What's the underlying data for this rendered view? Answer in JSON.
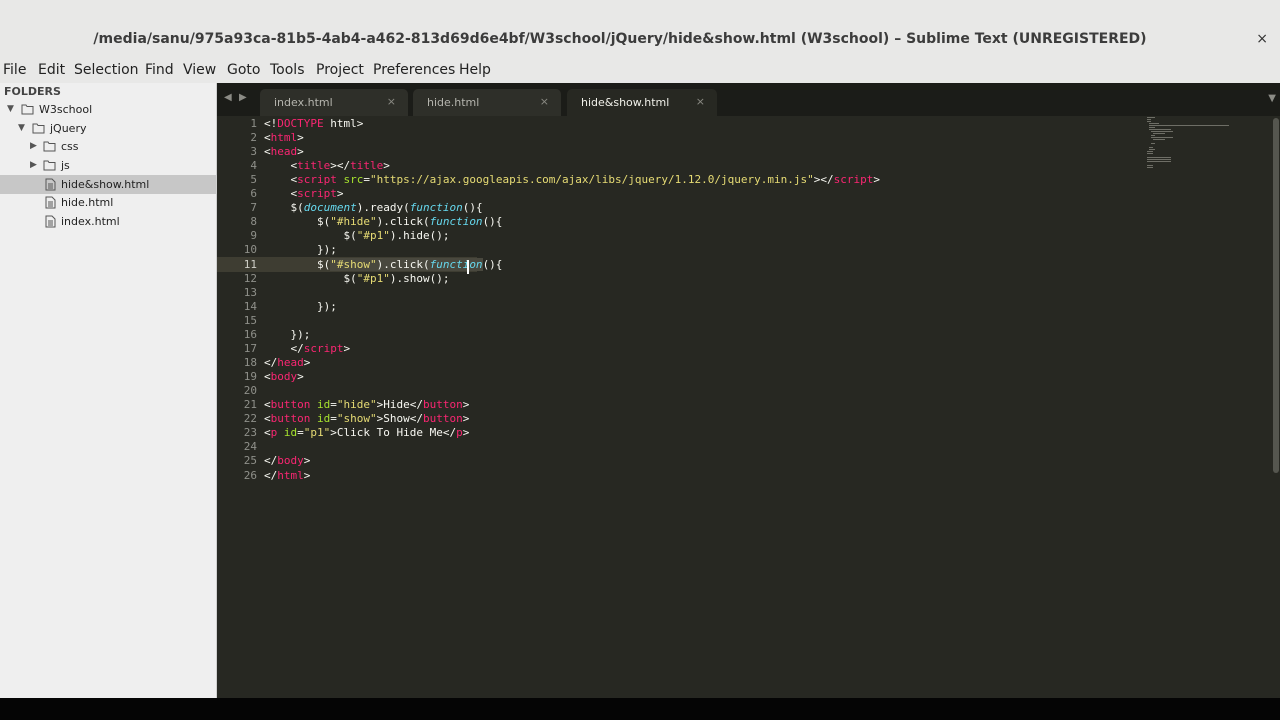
{
  "window": {
    "title": "/media/sanu/975a93ca-81b5-4ab4-a462-813d69d6e4bf/W3school/jQuery/hide&show.html (W3school) – Sublime Text (UNREGISTERED)",
    "close_glyph": "×"
  },
  "menu": [
    "File",
    "Edit",
    "Selection",
    "Find",
    "View",
    "Goto",
    "Tools",
    "Project",
    "Preferences",
    "Help"
  ],
  "sidebar": {
    "header": "FOLDERS",
    "tree": [
      {
        "label": "W3school",
        "type": "folder-open"
      },
      {
        "label": "jQuery",
        "type": "folder-open"
      },
      {
        "label": "css",
        "type": "folder"
      },
      {
        "label": "js",
        "type": "folder"
      },
      {
        "label": "hide&show.html",
        "type": "file"
      },
      {
        "label": "hide.html",
        "type": "file"
      },
      {
        "label": "index.html",
        "type": "file"
      }
    ]
  },
  "tabs": [
    {
      "label": "index.html",
      "close": "×"
    },
    {
      "label": "hide.html",
      "close": "×"
    },
    {
      "label": "hide&show.html",
      "close": "×"
    }
  ],
  "editor": {
    "line_numbers": [
      "1",
      "2",
      "3",
      "4",
      "5",
      "6",
      "7",
      "8",
      "9",
      "10",
      "11",
      "12",
      "13",
      "14",
      "15",
      "16",
      "17",
      "18",
      "19",
      "20",
      "21",
      "22",
      "23",
      "24",
      "25",
      "26"
    ],
    "tokens": {
      "l1a": "<!",
      "l1b": "DOCTYPE",
      "l1c": " html>",
      "l2a": "<",
      "l2b": "html",
      "l2c": ">",
      "l3a": "<",
      "l3b": "head",
      "l3c": ">",
      "l4a": "    <",
      "l4b": "title",
      "l4c": "></",
      "l4d": "title",
      "l4e": ">",
      "l5a": "    <",
      "l5b": "script",
      "l5c": " src",
      "l5d": "=",
      "l5e": "\"https://ajax.googleapis.com/ajax/libs/jquery/1.12.0/jquery.min.js\"",
      "l5f": "></",
      "l5g": "script",
      "l5h": ">",
      "l6a": "    <",
      "l6b": "script",
      "l6c": ">",
      "l7a": "    $(",
      "l7b": "document",
      "l7c": ").ready(",
      "l7d": "function",
      "l7e": "(){",
      "l8a": "        $(",
      "l8b": "\"#hide\"",
      "l8c": ").click(",
      "l8d": "function",
      "l8e": "(){",
      "l9a": "            $(",
      "l9b": "\"#p1\"",
      "l9c": ").hide();",
      "l10a": "        });",
      "l11a": "        $(",
      "l11b": "\"#show\"",
      "l11c": ").click(",
      "l11d": "function",
      "l11e": "(){",
      "l12a": "            $(",
      "l12b": "\"#p1\"",
      "l12c": ").show();",
      "l14a": "        });",
      "l16a": "    });",
      "l17a": "    </",
      "l17b": "script",
      "l17c": ">",
      "l18a": "</",
      "l18b": "head",
      "l18c": ">",
      "l19a": "<",
      "l19b": "body",
      "l19c": ">",
      "l21a": "<",
      "l21b": "button",
      "l21c": " id",
      "l21d": "=",
      "l21e": "\"hide\"",
      "l21f": ">Hide</",
      "l21g": "button",
      "l21h": ">",
      "l22a": "<",
      "l22b": "button",
      "l22c": " id",
      "l22d": "=",
      "l22e": "\"show\"",
      "l22f": ">Show</",
      "l22g": "button",
      "l22h": ">",
      "l23a": "<",
      "l23b": "p",
      "l23c": " id",
      "l23d": "=",
      "l23e": "\"p1\"",
      "l23f": ">Click To Hide Me</",
      "l23g": "p",
      "l23h": ">",
      "l25a": "</",
      "l25b": "body",
      "l25c": ">",
      "l26a": "</",
      "l26b": "html",
      "l26c": ">"
    }
  },
  "theme": {
    "background": "#272822",
    "tag": "#f92672",
    "string": "#e6db74",
    "attribute": "#a6e22e",
    "keyword": "#66d9ef",
    "text": "#f8f8f2",
    "line_number": "#8f908a"
  }
}
